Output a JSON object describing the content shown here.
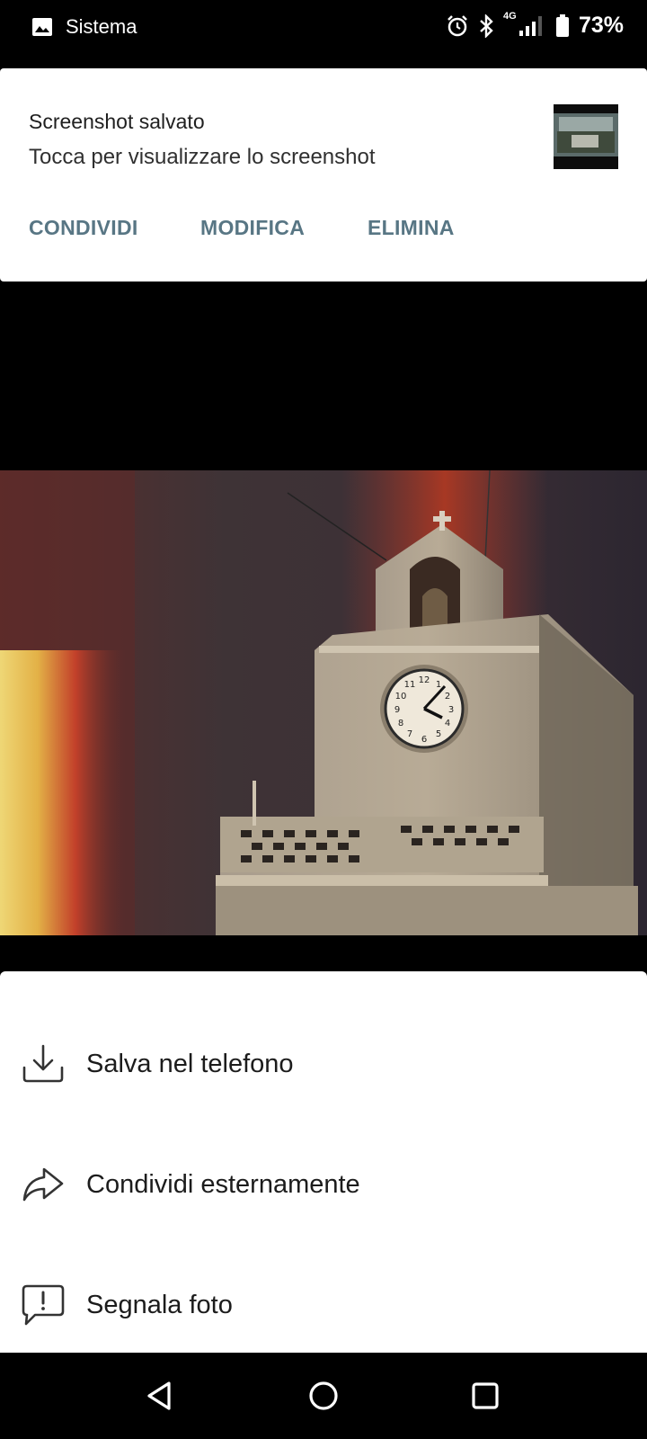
{
  "status_bar": {
    "app_name": "Sistema",
    "network_label": "4G",
    "battery_percent": "73%",
    "battery_level": 0.73
  },
  "notification": {
    "title": "Screenshot salvato",
    "body": "Tocca per visualizzare lo screenshot",
    "actions": {
      "share": "CONDIVIDI",
      "edit": "MODIFICA",
      "delete": "ELIMINA"
    },
    "action_color": "#587684"
  },
  "photo": {
    "subject": "clock-tower",
    "clock_numerals": [
      "12",
      "1",
      "2",
      "3",
      "4",
      "5",
      "6",
      "7",
      "8",
      "9",
      "10",
      "11"
    ]
  },
  "sheet": {
    "items": [
      {
        "label": "Salva nel telefono",
        "icon": "download-icon"
      },
      {
        "label": "Condividi esternamente",
        "icon": "share-arrow-icon"
      },
      {
        "label": "Segnala foto",
        "icon": "report-icon"
      }
    ]
  },
  "navbar": {
    "buttons": [
      "back-icon",
      "home-icon",
      "recents-icon"
    ]
  }
}
